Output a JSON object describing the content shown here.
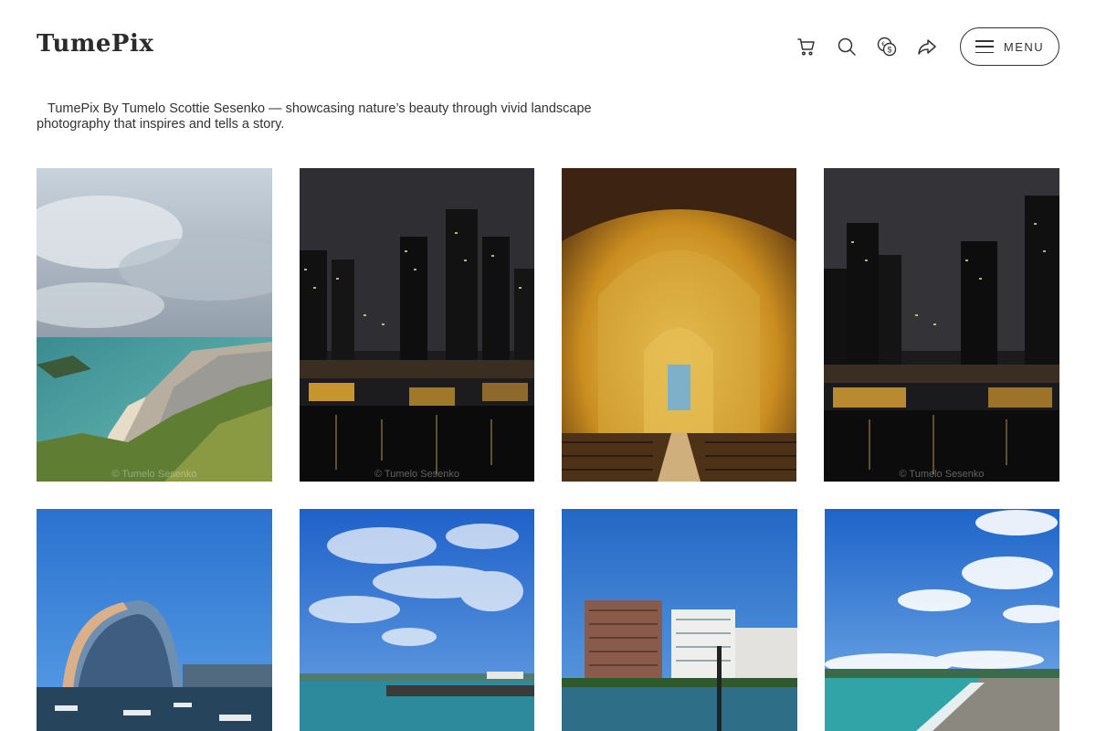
{
  "brand": {
    "logo_text": "TumePix"
  },
  "header": {
    "icons": [
      "cart-icon",
      "search-icon",
      "currency-icon",
      "share-icon"
    ],
    "menu_label": "MENU"
  },
  "intro": {
    "tagline": "TumePix By Tumelo Scottie Sesenko — showcasing nature’s beauty through vivid landscape photography that inspires and tells a story."
  },
  "gallery": {
    "watermark": "© Tumelo Sesenko",
    "photos": [
      {
        "subject": "coastal beach town viewed from a hilltop under cloudy sky"
      },
      {
        "subject": "city skyline at night with harbour wharves"
      },
      {
        "subject": "golden lit cathedral interior with vaulted ceiling"
      },
      {
        "subject": "night skyline over ferry wharves"
      },
      {
        "subject": "curved glass hotel building over marina"
      },
      {
        "subject": "blue sky with scattered clouds over a jetty"
      },
      {
        "subject": "apartment buildings on a harbour waterfront"
      },
      {
        "subject": "sandy beach with blue sky and clouds"
      }
    ]
  },
  "colors": {
    "text": "#2b2b2b",
    "background": "#ffffff",
    "border": "#333333"
  }
}
